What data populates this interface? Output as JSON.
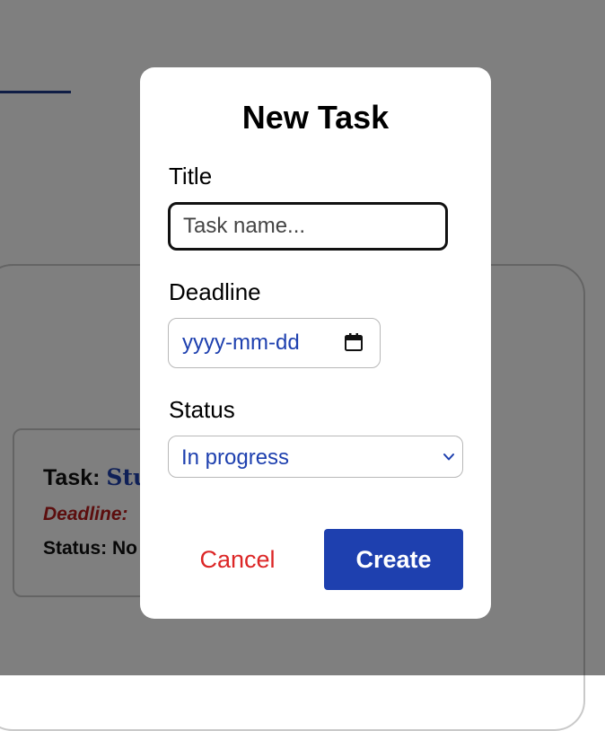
{
  "background": {
    "task_label": "Task:",
    "task_name": "Stu",
    "deadline_label": "Deadline:",
    "status_label": "Status: No"
  },
  "modal": {
    "title": "New Task",
    "title_field": {
      "label": "Title",
      "value": "",
      "placeholder": "Task name..."
    },
    "deadline_field": {
      "label": "Deadline",
      "placeholder": "yyyy-mm-dd",
      "icon": "calendar-icon"
    },
    "status_field": {
      "label": "Status",
      "selected": "In progress",
      "icon": "chevron-down-icon"
    },
    "cancel_label": "Cancel",
    "create_label": "Create"
  },
  "colors": {
    "accent": "#1e40af",
    "danger": "#dc2626",
    "overlay": "rgba(0,0,0,0.5)"
  }
}
